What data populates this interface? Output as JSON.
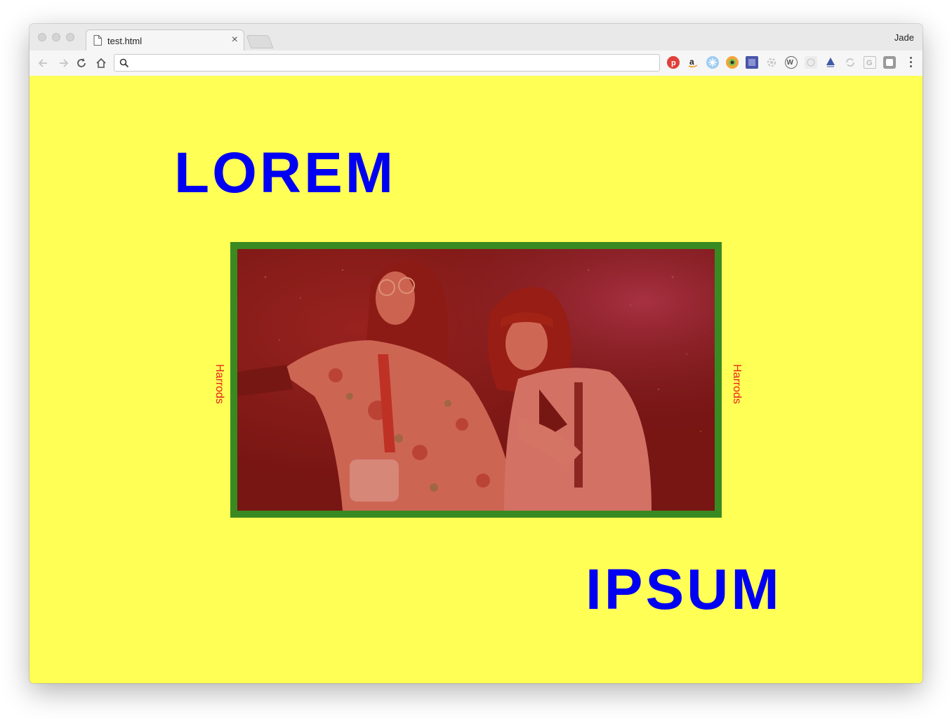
{
  "browser": {
    "tab": {
      "title": "test.html",
      "close_glyph": "×"
    },
    "profile_name": "Jade",
    "omnibox": {
      "value": "",
      "placeholder": ""
    },
    "extensions": [
      "pinterest-icon",
      "amazon-icon",
      "snowflake-icon",
      "color-picker-icon",
      "screencast-icon",
      "gear-extension-icon",
      "wordpress-icon",
      "grid-extension-icon",
      "triangle-extension-icon",
      "sync-extension-icon",
      "g-extension-icon",
      "square-extension-icon"
    ]
  },
  "page": {
    "background": "#ffff55",
    "headline_top": "LOREM",
    "headline_bottom": "IPSUM",
    "headline_color": "#0000f2",
    "side_label_left": "Harrods",
    "side_label_right": "Harrods",
    "side_label_color": "#e8241c",
    "frame_color": "#3a8a22",
    "photo_tint": "#b4201c"
  }
}
